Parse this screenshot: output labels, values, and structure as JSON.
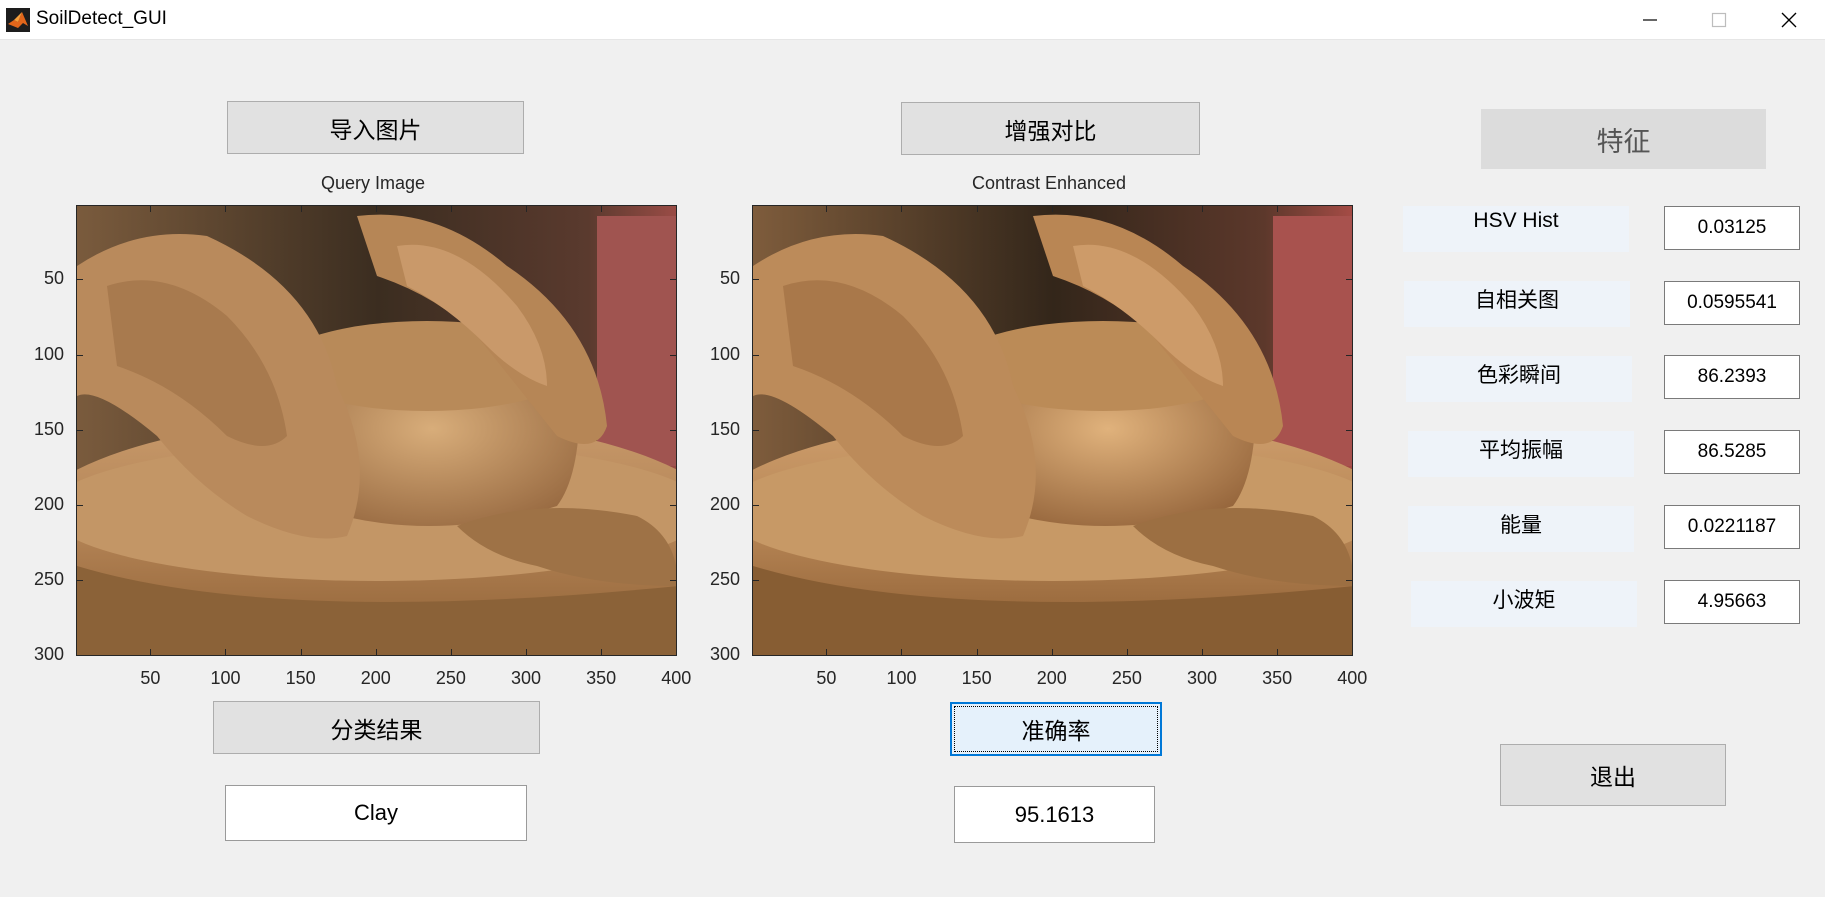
{
  "window": {
    "title": "SoilDetect_GUI"
  },
  "buttons": {
    "import_image": "导入图片",
    "enhance_contrast": "增强对比",
    "features": "特征",
    "classification_result": "分类结果",
    "accuracy": "准确率",
    "exit": "退出"
  },
  "results": {
    "class": "Clay",
    "accuracy": "95.1613"
  },
  "features": [
    {
      "label": "HSV Hist",
      "value": "0.03125"
    },
    {
      "label": "自相关图",
      "value": "0.0595541"
    },
    {
      "label": "色彩瞬间",
      "value": "86.2393"
    },
    {
      "label": "平均振幅",
      "value": "86.5285"
    },
    {
      "label": "能量",
      "value": "0.0221187"
    },
    {
      "label": "小波矩",
      "value": "4.95663"
    }
  ],
  "axes": [
    {
      "title": "Query Image",
      "xticks": [
        "50",
        "100",
        "150",
        "200",
        "250",
        "300",
        "350",
        "400"
      ],
      "yticks": [
        "50",
        "100",
        "150",
        "200",
        "250",
        "300"
      ]
    },
    {
      "title": "Contrast Enhanced",
      "xticks": [
        "50",
        "100",
        "150",
        "200",
        "250",
        "300",
        "350",
        "400"
      ],
      "yticks": [
        "50",
        "100",
        "150",
        "200",
        "250",
        "300"
      ]
    }
  ],
  "colors": {
    "background": "#f0f0f0",
    "button_face": "#e1e1e1",
    "focus_border": "#0078d7",
    "label_bg": "#eef3f9"
  }
}
